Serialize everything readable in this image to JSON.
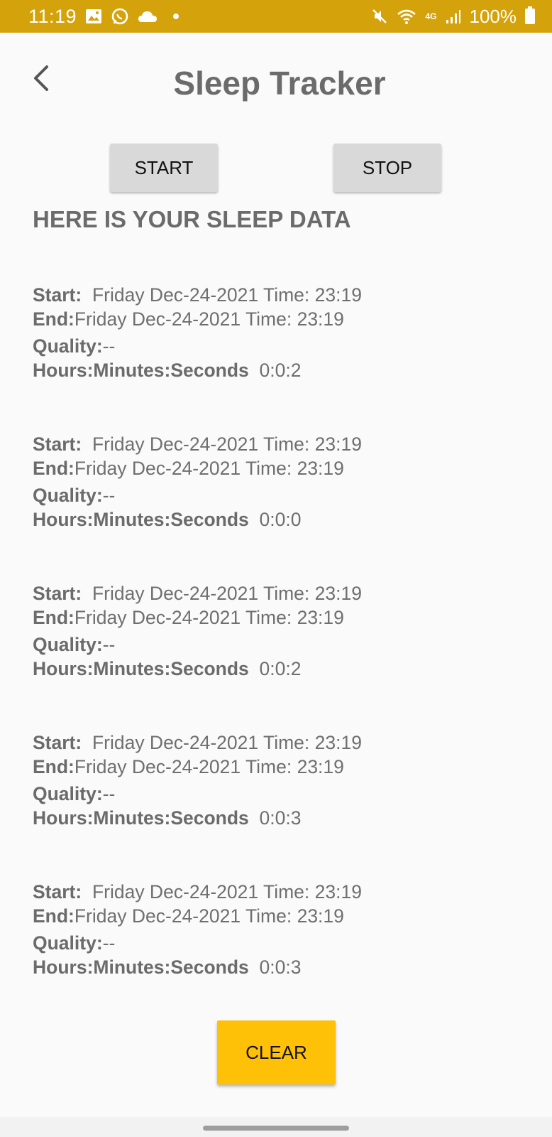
{
  "status_bar": {
    "time": "11:19",
    "network": "4G",
    "battery": "100%"
  },
  "app_bar": {
    "title": "Sleep Tracker"
  },
  "buttons": {
    "start": "START",
    "stop": "STOP",
    "clear": "CLEAR"
  },
  "heading": "HERE IS YOUR SLEEP DATA",
  "labels": {
    "start": "Start:",
    "end": "End:",
    "quality": "Quality:",
    "duration": "Hours:Minutes:Seconds"
  },
  "entries": [
    {
      "start": "Friday Dec-24-2021 Time: 23:19",
      "end": "Friday Dec-24-2021 Time: 23:19",
      "quality": "--",
      "duration": "0:0:2"
    },
    {
      "start": "Friday Dec-24-2021 Time: 23:19",
      "end": "Friday Dec-24-2021 Time: 23:19",
      "quality": "--",
      "duration": "0:0:0"
    },
    {
      "start": "Friday Dec-24-2021 Time: 23:19",
      "end": "Friday Dec-24-2021 Time: 23:19",
      "quality": "--",
      "duration": "0:0:2"
    },
    {
      "start": "Friday Dec-24-2021 Time: 23:19",
      "end": "Friday Dec-24-2021 Time: 23:19",
      "quality": "--",
      "duration": "0:0:3"
    },
    {
      "start": "Friday Dec-24-2021 Time: 23:19",
      "end": "Friday Dec-24-2021 Time: 23:19",
      "quality": "--",
      "duration": "0:0:3"
    }
  ],
  "colors": {
    "status_bar": "#d4a20a",
    "clear_button": "#ffc107",
    "secondary_button": "#d9d9d9",
    "text": "#6b6b6b"
  },
  "icons": [
    "image-icon",
    "whatsapp-icon",
    "cloud-icon",
    "mute-icon",
    "wifi-icon",
    "signal-icon",
    "battery-icon",
    "back-arrow-icon"
  ]
}
